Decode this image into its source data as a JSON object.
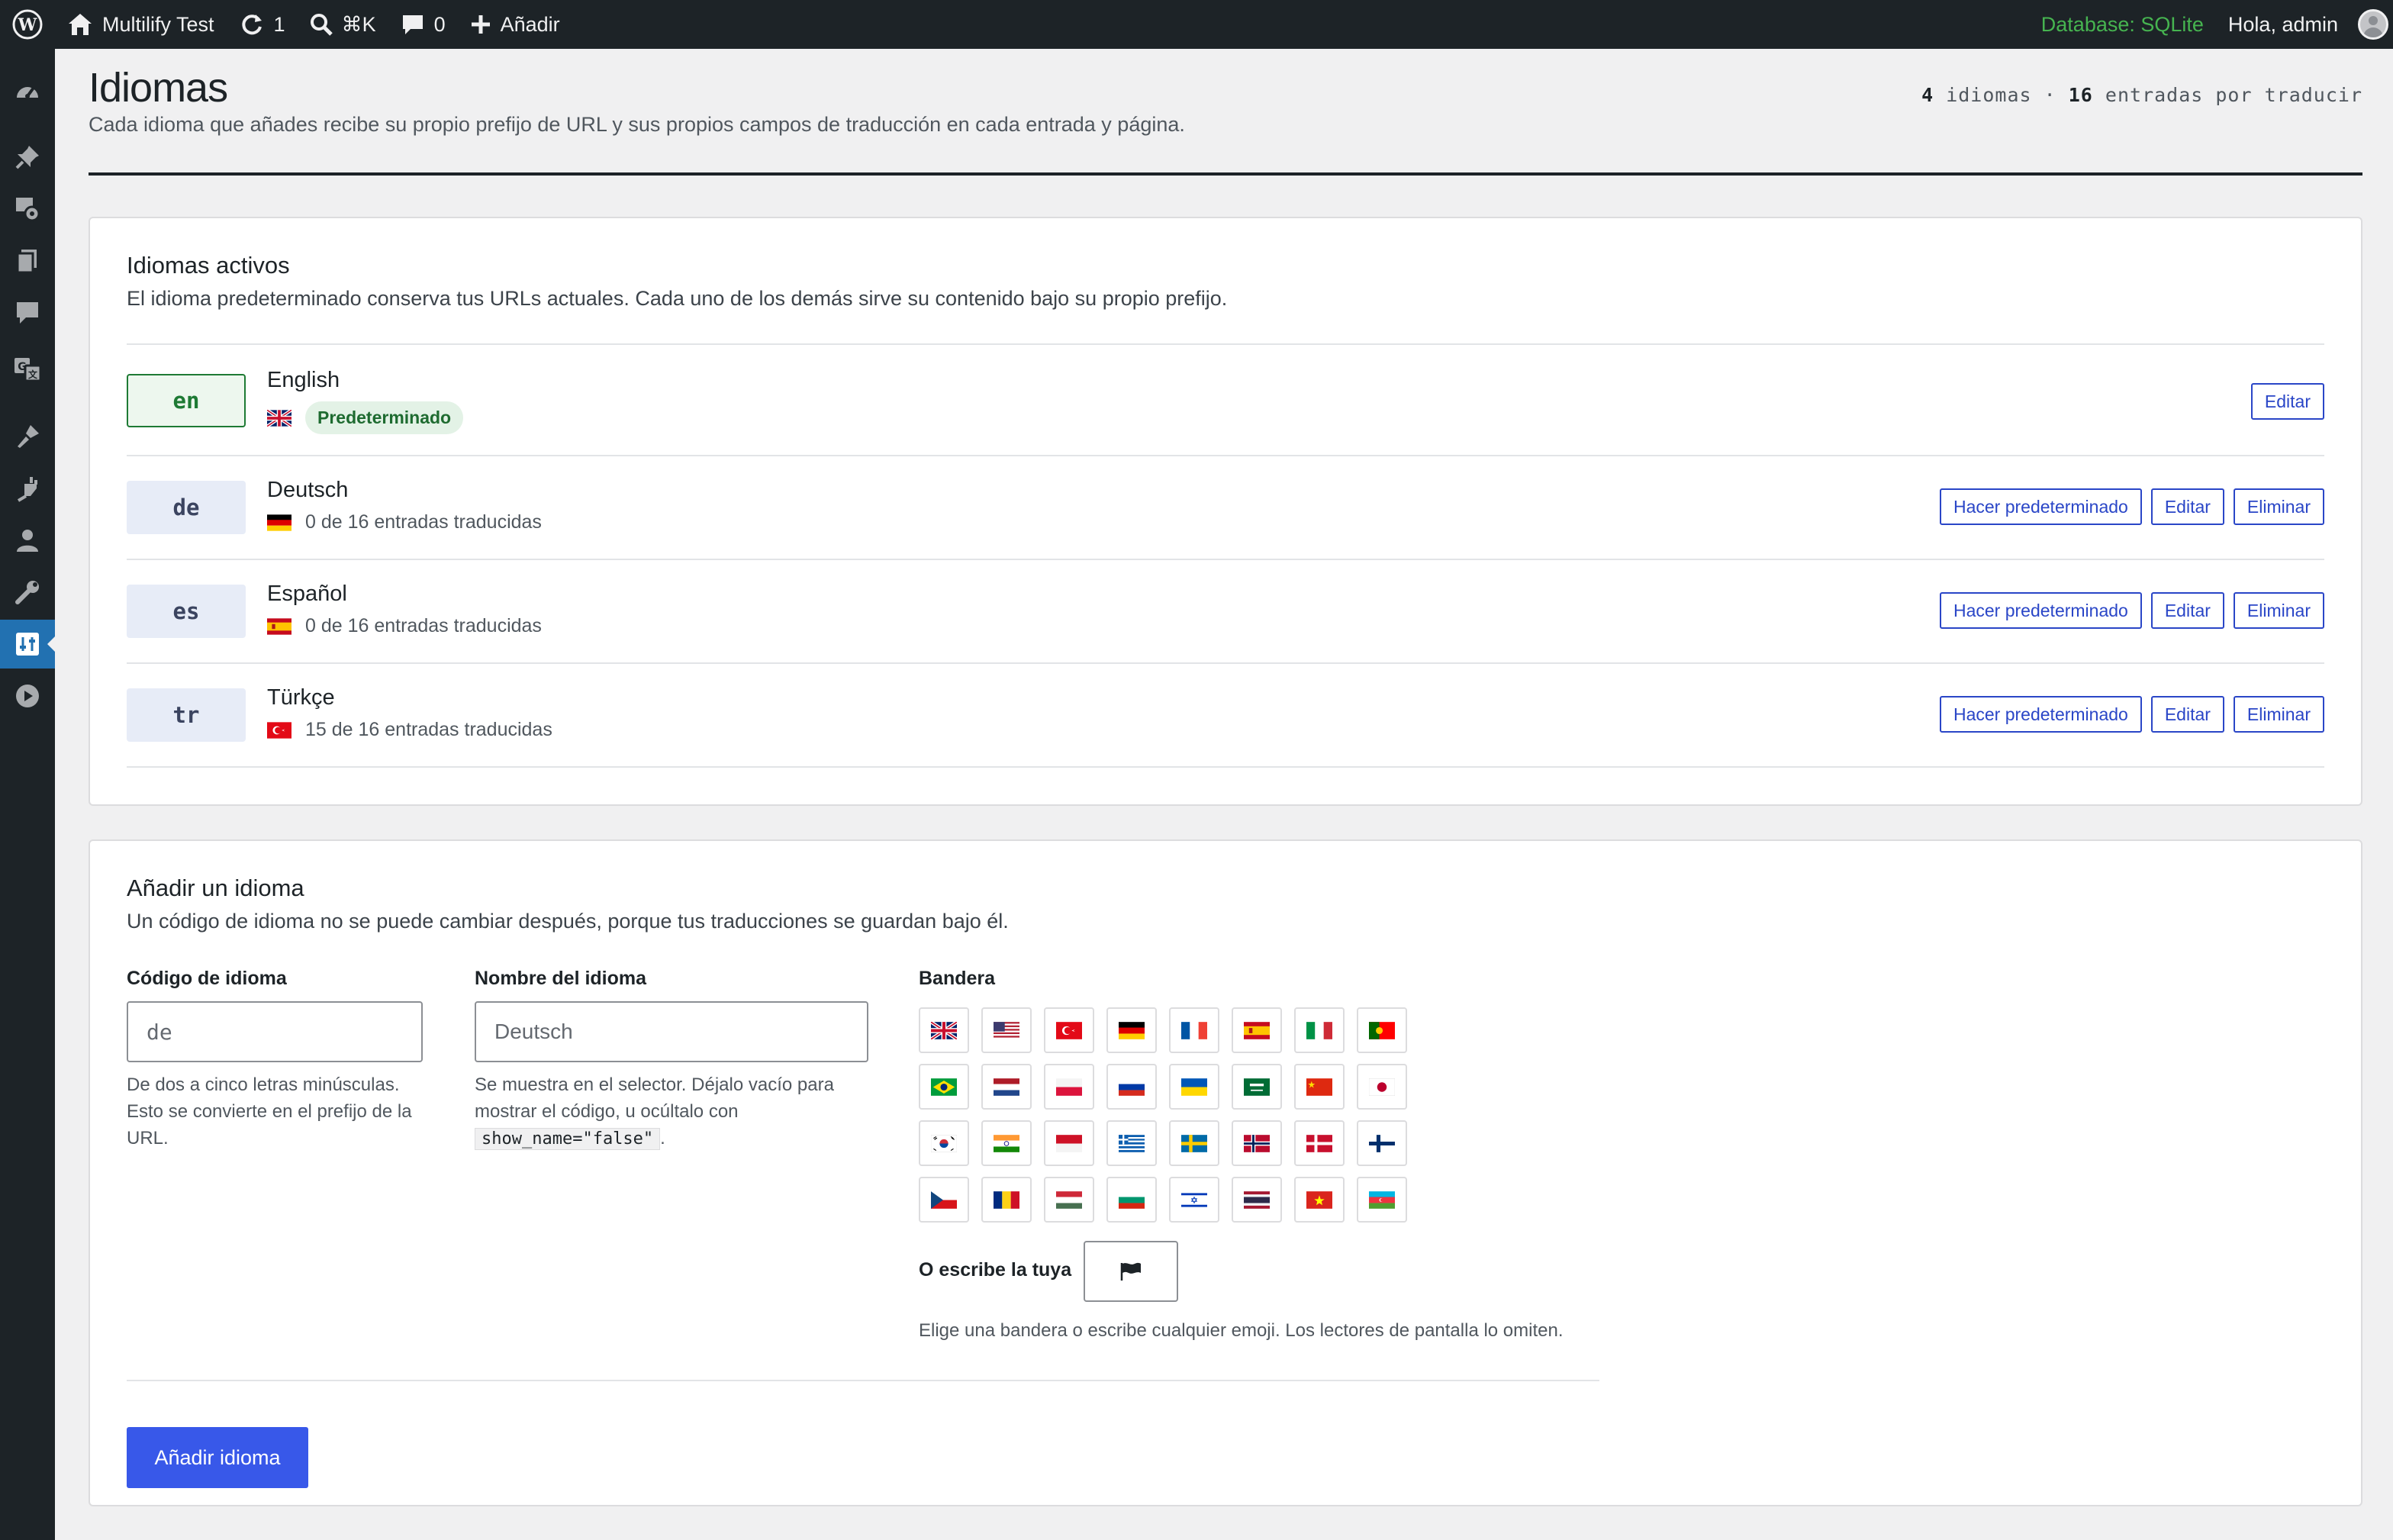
{
  "adminbar": {
    "site_name": "Multilify Test",
    "updates_count": "1",
    "search_shortcut": "⌘K",
    "comments_count": "0",
    "new_label": "Añadir",
    "db_label": "Database: SQLite",
    "greeting": "Hola, admin"
  },
  "sidebar": {
    "icons": [
      "dashboard-icon",
      "pin-icon",
      "media-icon",
      "pages-icon",
      "comments-icon",
      "translation-icon",
      "appearance-icon",
      "plugins-icon",
      "users-icon",
      "tools-icon",
      "settings-icon",
      "play-icon"
    ],
    "active": "settings-icon"
  },
  "page": {
    "title": "Idiomas",
    "description": "Cada idioma que añades recibe su propio prefijo de URL y sus propios campos de traducción en cada entrada y página.",
    "stats_languages_count": "4",
    "stats_languages_label": "idiomas",
    "stats_separator": "·",
    "stats_pending_count": "16",
    "stats_pending_label": "entradas por traducir"
  },
  "active_languages": {
    "title": "Idiomas activos",
    "subtitle": "El idioma predeterminado conserva tus URLs actuales. Cada uno de los demás sirve su contenido bajo su propio prefijo.",
    "default_badge": "Predeterminado",
    "make_default_label": "Hacer predeterminado",
    "edit_label": "Editar",
    "delete_label": "Eliminar",
    "rows": [
      {
        "code": "en",
        "name": "English",
        "flag": "gb-flag",
        "is_default": true
      },
      {
        "code": "de",
        "name": "Deutsch",
        "flag": "de-flag",
        "progress": "0 de 16 entradas traducidas"
      },
      {
        "code": "es",
        "name": "Español",
        "flag": "es-flag",
        "progress": "0 de 16 entradas traducidas"
      },
      {
        "code": "tr",
        "name": "Türkçe",
        "flag": "tr-flag",
        "progress": "15 de 16 entradas traducidas"
      }
    ]
  },
  "add_language": {
    "title": "Añadir un idioma",
    "subtitle": "Un código de idioma no se puede cambiar después, porque tus traducciones se guardan bajo él.",
    "code_label": "Código de idioma",
    "code_placeholder": "de",
    "code_help": "De dos a cinco letras minúsculas. Esto se convierte en el prefijo de la URL.",
    "name_label": "Nombre del idioma",
    "name_placeholder": "Deutsch",
    "name_help_prefix": "Se muestra en el selector. Déjalo vacío para mostrar el código, u ocúltalo con",
    "name_help_code": "show_name=\"false\"",
    "name_help_suffix": ".",
    "flag_label": "Bandera",
    "flag_options": [
      "gb",
      "us",
      "tr",
      "de",
      "fr",
      "es",
      "it",
      "pt",
      "br",
      "nl",
      "pl",
      "ru",
      "ua",
      "sa",
      "cn",
      "jp",
      "kr",
      "in",
      "id",
      "gr",
      "se",
      "no",
      "dk",
      "fi",
      "cz",
      "ro",
      "hu",
      "bg",
      "il",
      "th",
      "vn",
      "az"
    ],
    "custom_label": "O escribe la tuya",
    "custom_value_icon": "black-flag-icon",
    "flag_help": "Elige una bandera o escribe cualquier emoji. Los lectores de pantalla lo omiten.",
    "submit_label": "Añadir idioma"
  },
  "colors": {
    "accent": "#3858e9",
    "adminbar": "#1d2327",
    "default_green": "#1e7a34",
    "db_green": "#46b450"
  }
}
